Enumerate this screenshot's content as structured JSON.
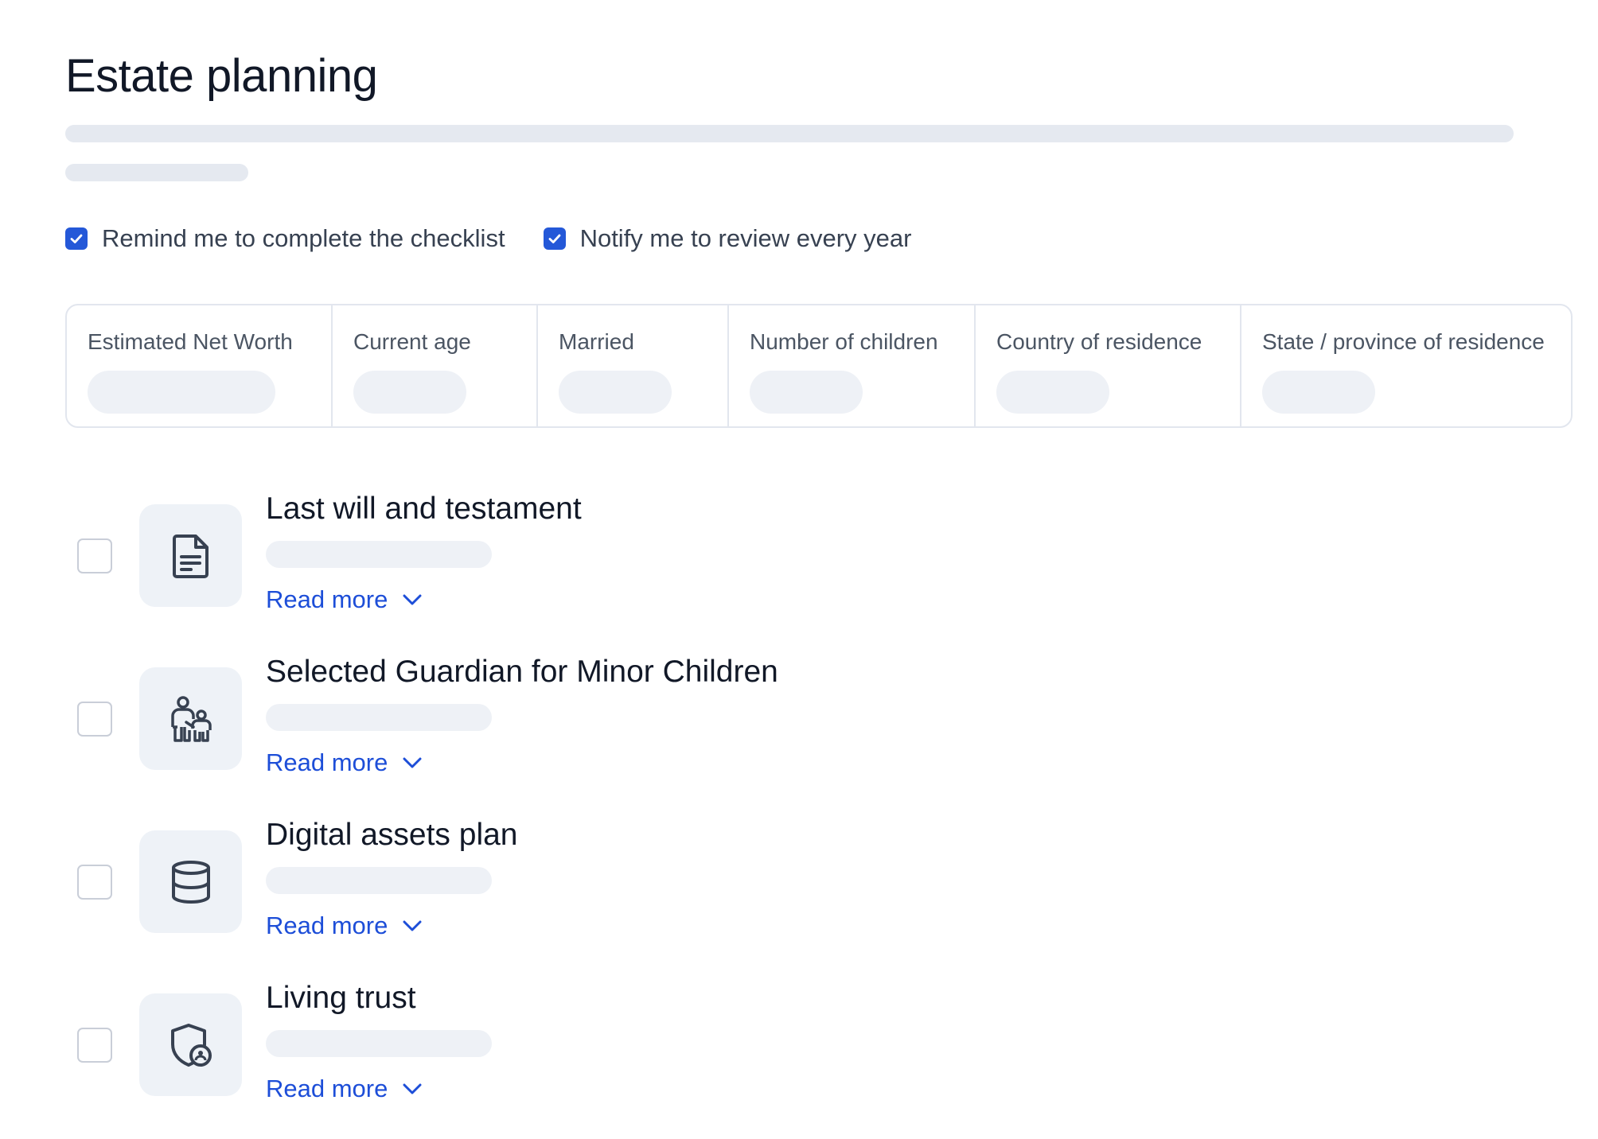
{
  "page": {
    "title": "Estate planning"
  },
  "preferences": [
    {
      "label": "Remind me to complete the checklist",
      "checked": true
    },
    {
      "label": "Notify me to review every year",
      "checked": true
    }
  ],
  "profile_fields": [
    {
      "label": "Estimated Net Worth"
    },
    {
      "label": "Current age"
    },
    {
      "label": "Married"
    },
    {
      "label": "Number of children"
    },
    {
      "label": "Country of residence"
    },
    {
      "label": "State / province of residence"
    }
  ],
  "checklist": {
    "read_more_label": "Read more",
    "items": [
      {
        "title": "Last will and testament",
        "icon": "document-icon",
        "checked": false
      },
      {
        "title": "Selected Guardian for Minor Children",
        "icon": "parent-child-icon",
        "checked": false
      },
      {
        "title": "Digital assets plan",
        "icon": "database-icon",
        "checked": false
      },
      {
        "title": "Living trust",
        "icon": "shield-user-icon",
        "checked": false
      }
    ]
  },
  "colors": {
    "accent": "#2458d8",
    "link": "#1d4ed8",
    "skeleton": "#e5e9f0",
    "icon_tile": "#eef2f7",
    "border": "#e2e6ee"
  }
}
